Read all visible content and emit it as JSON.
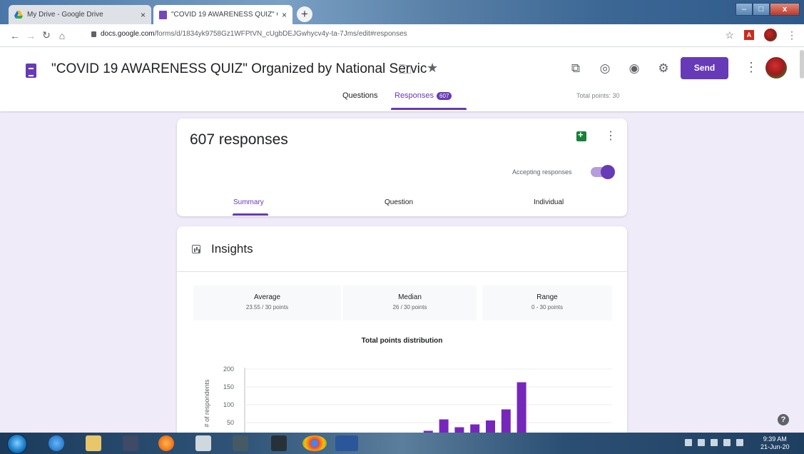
{
  "browser": {
    "tabs": [
      {
        "title": "My Drive - Google Drive",
        "active": false
      },
      {
        "title": "\"COVID 19 AWARENESS QUIZ\" C",
        "active": true
      }
    ],
    "new_tab": "+",
    "url_host": "docs.google.com",
    "url_path": "/forms/d/1834yk9758Gz1WFPtVN_cUgbDEJGwhycv4y-ta-7Jms/edit#responses"
  },
  "form": {
    "title": "\"COVID 19 AWARENESS QUIZ\" Organized by National Servic",
    "send_label": "Send",
    "tabs": {
      "questions": "Questions",
      "responses": "Responses",
      "responses_count": "607"
    },
    "total_points": "Total points: 30"
  },
  "responses": {
    "count_label": "607 responses",
    "accepting_label": "Accepting responses",
    "accepting": true,
    "subtabs": [
      "Summary",
      "Question",
      "Individual"
    ]
  },
  "insights": {
    "title": "Insights",
    "stats": [
      {
        "label": "Average",
        "value": "23.55 / 30 points"
      },
      {
        "label": "Median",
        "value": "26 / 30 points"
      },
      {
        "label": "Range",
        "value": "0 - 30 points"
      }
    ]
  },
  "chart_data": {
    "type": "bar",
    "title": "Total points distribution",
    "ylabel": "# of respondents",
    "xlabel": "",
    "ylim": [
      0,
      200
    ],
    "yticks": [
      200,
      150,
      100,
      50
    ],
    "values": [
      22,
      27,
      59,
      37,
      45,
      56,
      87,
      163
    ],
    "color": "#7627bb"
  },
  "taskbar": {
    "time": "9:39 AM",
    "date": "21-Jun-20"
  },
  "colors": {
    "accent": "#673ab7",
    "background": "#f0ebf8"
  }
}
